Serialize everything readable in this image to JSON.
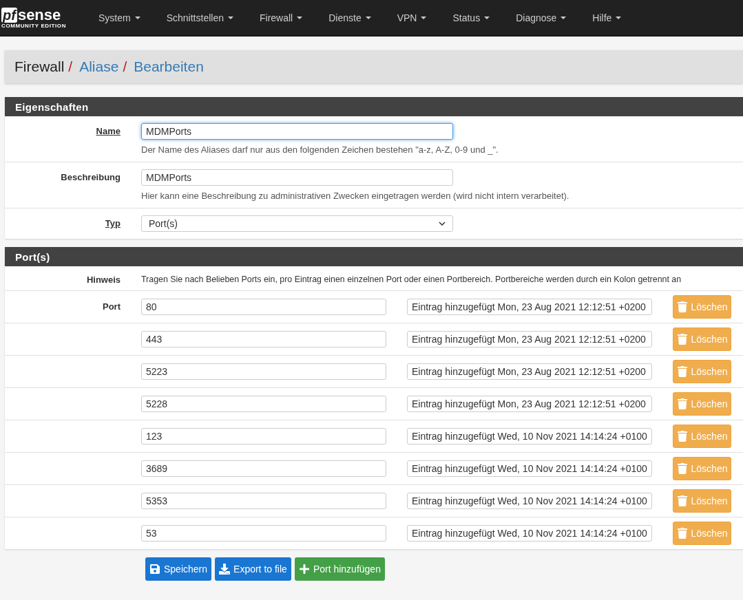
{
  "logo": {
    "mark": "pf",
    "word": "sense",
    "edition": "COMMUNITY EDITION"
  },
  "nav": [
    "System",
    "Schnittstellen",
    "Firewall",
    "Dienste",
    "VPN",
    "Status",
    "Diagnose",
    "Hilfe"
  ],
  "breadcrumb": [
    {
      "label": "Firewall",
      "kind": "text",
      "separator": "/"
    },
    {
      "label": "Aliase",
      "kind": "link",
      "separator": "/"
    },
    {
      "label": "Bearbeiten",
      "kind": "link"
    }
  ],
  "properties": {
    "title": "Eigenschaften",
    "fields": [
      {
        "kind": "input",
        "label": "Name",
        "required": true,
        "focused": true,
        "value": "MDMPorts",
        "help": "Der Name des Aliases darf nur aus den folgenden Zeichen bestehen \"a-z, A-Z, 0-9 und _\"."
      },
      {
        "kind": "input",
        "label": "Beschreibung",
        "required": false,
        "focused": false,
        "value": "MDMPorts",
        "help": "Hier kann eine Beschreibung zu administrativen Zwecken eingetragen werden (wird nicht intern verarbeitet)."
      },
      {
        "kind": "select",
        "label": "Typ",
        "required": true,
        "value": "Port(s)"
      }
    ]
  },
  "ports": {
    "title": "Port(s)",
    "hint_label": "Hinweis",
    "hint": "Tragen Sie nach Belieben Ports ein, pro Eintrag einen einzelnen Port oder einen Portbereich. Portbereiche werden durch ein Kolon getrennt an",
    "port_label": "Port",
    "entries": [
      {
        "port": "80",
        "note": "Eintrag hinzugefügt Mon, 23 Aug 2021 12:12:51 +0200",
        "delete": "Löschen"
      },
      {
        "port": "443",
        "note": "Eintrag hinzugefügt Mon, 23 Aug 2021 12:12:51 +0200",
        "delete": "Löschen"
      },
      {
        "port": "5223",
        "note": "Eintrag hinzugefügt Mon, 23 Aug 2021 12:12:51 +0200",
        "delete": "Löschen"
      },
      {
        "port": "5228",
        "note": "Eintrag hinzugefügt Mon, 23 Aug 2021 12:12:51 +0200",
        "delete": "Löschen"
      },
      {
        "port": "123",
        "note": "Eintrag hinzugefügt Wed, 10 Nov 2021 14:14:24 +0100",
        "delete": "Löschen"
      },
      {
        "port": "3689",
        "note": "Eintrag hinzugefügt Wed, 10 Nov 2021 14:14:24 +0100",
        "delete": "Löschen"
      },
      {
        "port": "5353",
        "note": "Eintrag hinzugefügt Wed, 10 Nov 2021 14:14:24 +0100",
        "delete": "Löschen"
      },
      {
        "port": "53",
        "note": "Eintrag hinzugefügt Wed, 10 Nov 2021 14:14:24 +0100",
        "delete": "Löschen"
      }
    ]
  },
  "actions": [
    {
      "kind": "save",
      "label": "Speichern"
    },
    {
      "kind": "export",
      "label": "Export to file"
    },
    {
      "kind": "add",
      "label": "Port hinzufügen"
    }
  ]
}
